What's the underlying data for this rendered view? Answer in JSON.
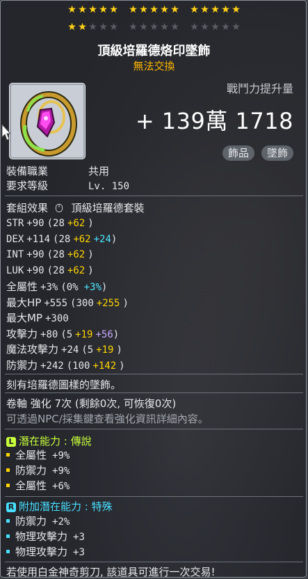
{
  "stars": {
    "rows": [
      [
        [
          1,
          1,
          1,
          1,
          1
        ],
        [
          1,
          1,
          1,
          1,
          1
        ],
        [
          1,
          1,
          1,
          1,
          1
        ]
      ],
      [
        [
          1,
          1,
          0,
          0,
          0
        ],
        [
          0,
          0,
          0,
          0,
          0
        ],
        [
          0,
          0,
          0,
          0,
          0
        ]
      ]
    ],
    "on_color": "#ffd21a",
    "off_color": "#5a5d63"
  },
  "item": {
    "name": "頂級培羅德烙印墜飾",
    "trade_status": "無法交換",
    "icon": "pendant-icon"
  },
  "combat_power": {
    "label": "戰鬥力提升量",
    "value": "+ 139萬 1718"
  },
  "tags": [
    "飾品",
    "墜飾"
  ],
  "requirements": {
    "job_label": "裝備職業",
    "job_value": "共用",
    "level_label": "要求等級",
    "level_value": "Lv. 150"
  },
  "set_effect": {
    "label": "套組效果",
    "icon": "mouse-icon",
    "value": "頂級培羅德套裝"
  },
  "stats": [
    {
      "name": "STR",
      "total": "+90",
      "base": "(28",
      "add1": "+62",
      "add2": "",
      "close": ")"
    },
    {
      "name": "DEX",
      "total": "+114",
      "base": "(28",
      "add1": "+62",
      "add2": "+24",
      "close": ")"
    },
    {
      "name": "INT",
      "total": "+90",
      "base": "(28",
      "add1": "+62",
      "add2": "",
      "close": ")"
    },
    {
      "name": "LUK",
      "total": "+90",
      "base": "(28",
      "add1": "+62",
      "add2": "",
      "close": ")"
    },
    {
      "name": "全屬性",
      "total": "+3%",
      "base": "(0%",
      "add1": "",
      "add2": "+3%",
      "close": ")"
    },
    {
      "name": "最大HP",
      "total": "+555",
      "base": "(300",
      "add1": "+255",
      "add2": "",
      "close": ")"
    },
    {
      "name": "最大MP",
      "total": "+300",
      "base": "",
      "add1": "",
      "add2": "",
      "close": ""
    },
    {
      "name": "攻擊力",
      "total": "+80",
      "base": "(5",
      "add1": "+19",
      "add2": "+56",
      "close": ")"
    },
    {
      "name": "魔法攻擊力",
      "total": "+24",
      "base": "(5",
      "add1": "+19",
      "add2": "",
      "close": ")"
    },
    {
      "name": "防禦力",
      "total": "+242",
      "base": "(100",
      "add1": "+142",
      "add2": "",
      "close": ")"
    }
  ],
  "description": "刻有培羅德圖樣的墜飾。",
  "scroll": {
    "text": "卷軸 強化 7次 (剩餘0次, 可恢復0次)",
    "hint": "可透過NPC/採集鍵查看強化資訊詳細內容。"
  },
  "potential": {
    "badge": "L",
    "label": "潛在能力 : 傳說",
    "color": "#c8ff3c",
    "lines": [
      {
        "name": "全屬性",
        "value": "+9%"
      },
      {
        "name": "防禦力",
        "value": "+9%"
      },
      {
        "name": "全屬性",
        "value": "+6%"
      }
    ]
  },
  "additional": {
    "badge": "R",
    "label": "附加潛在能力 : 特殊",
    "color": "#48e0ff",
    "lines": [
      {
        "name": "防禦力",
        "value": "+2%"
      },
      {
        "name": "物理攻擊力",
        "value": "+3"
      },
      {
        "name": "物理攻擊力",
        "value": "+3"
      }
    ]
  },
  "footer": "若使用白金神奇剪刀, 該道具可進行一次交易!"
}
